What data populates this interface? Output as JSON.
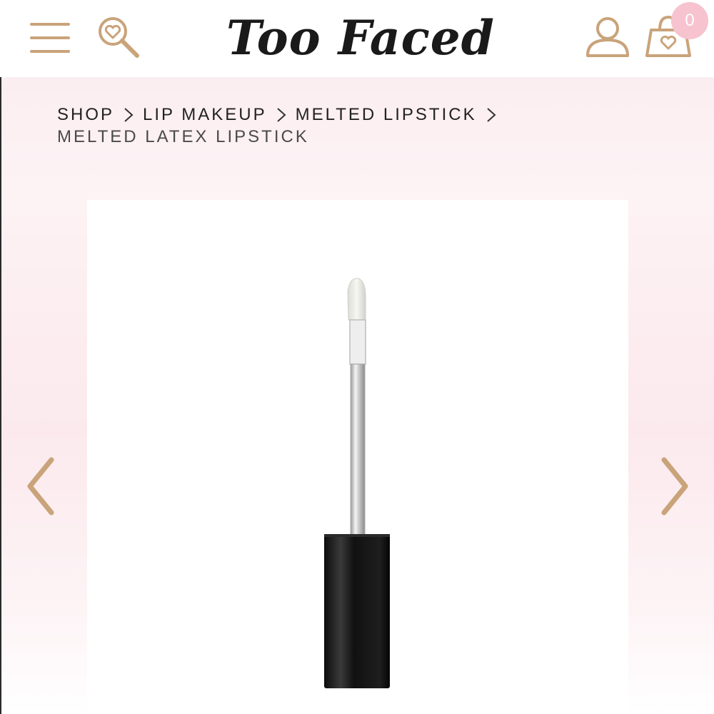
{
  "header": {
    "brand": "Too Faced",
    "cart_count": "0",
    "icons": {
      "menu": "hamburger-menu-icon",
      "search": "heart-magnifier-icon",
      "account": "user-icon",
      "cart": "shopping-bag-heart-icon"
    }
  },
  "breadcrumb": {
    "items": [
      "SHOP",
      "LIP MAKEUP",
      "MELTED LIPSTICK"
    ],
    "current": "MELTED LATEX LIPSTICK"
  },
  "carousel": {
    "prev_icon": "chevron-left-icon",
    "next_icon": "chevron-right-icon"
  },
  "colors": {
    "gold": "#c9a37a",
    "pink_band": "#fbeef1",
    "badge": "#f6c3cf",
    "text": "#222222"
  }
}
